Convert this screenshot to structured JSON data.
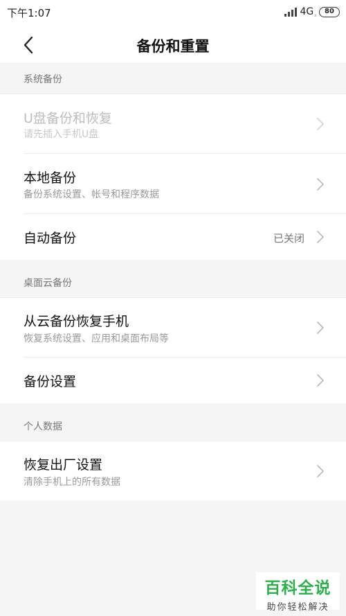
{
  "status_bar": {
    "time": "下午1:07",
    "network": "4G",
    "network_sub": "ᵢₗ",
    "battery": "80"
  },
  "header": {
    "title": "备份和重置",
    "back_icon": "chevron-left-icon"
  },
  "sections": [
    {
      "label": "系统备份",
      "items": [
        {
          "title": "U盘备份和恢复",
          "subtitle": "请先插入手机U盘",
          "disabled": true
        },
        {
          "title": "本地备份",
          "subtitle": "备份系统设置、帐号和程序数据"
        },
        {
          "title": "自动备份",
          "value": "已关闭"
        }
      ]
    },
    {
      "label": "桌面云备份",
      "items": [
        {
          "title": "从云备份恢复手机",
          "subtitle": "恢复系统设置、应用和桌面布局等"
        },
        {
          "title": "备份设置"
        }
      ]
    },
    {
      "label": "个人数据",
      "items": [
        {
          "title": "恢复出厂设置",
          "subtitle": "清除手机上的所有数据"
        }
      ]
    }
  ],
  "watermark": {
    "logo": "百科全说",
    "slogan": "助你轻松解决"
  },
  "colors": {
    "background": "#f5f5f5",
    "card": "#ffffff",
    "watermark_green": "#2bb04a"
  }
}
